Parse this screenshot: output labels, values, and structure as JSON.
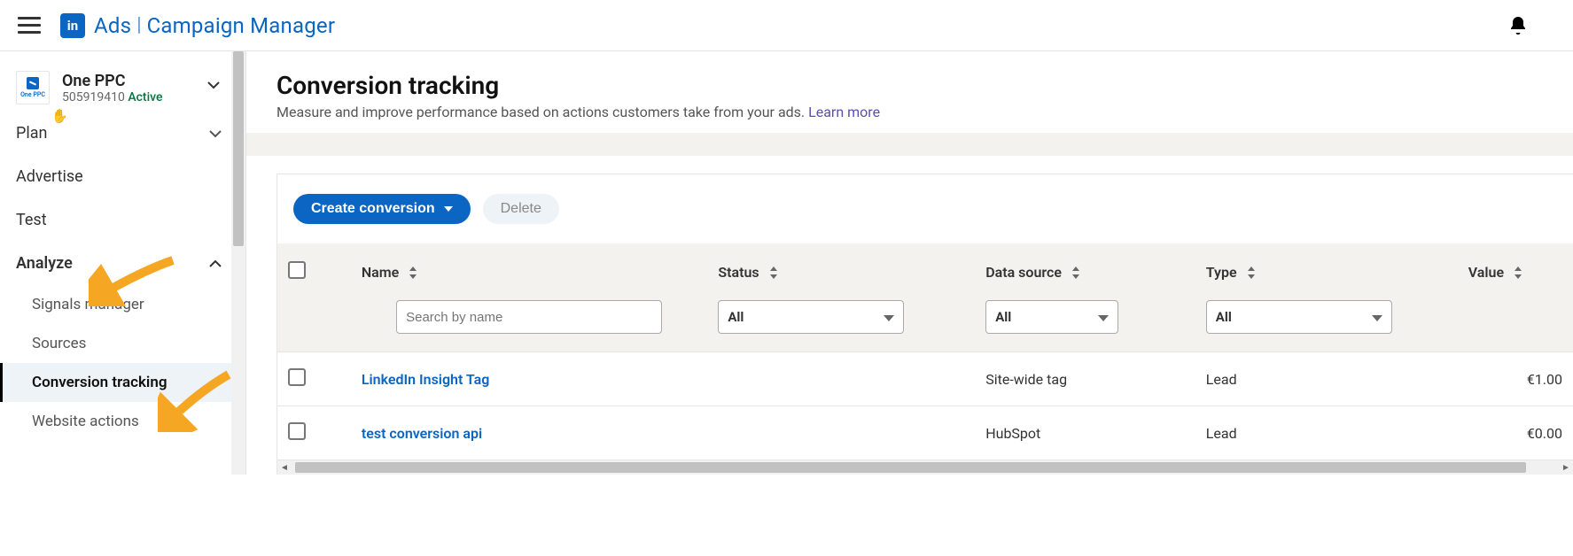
{
  "header": {
    "brand_ads": "Ads",
    "brand_cm": "Campaign Manager",
    "logo_text": "in"
  },
  "account": {
    "name": "One PPC",
    "id": "505919410",
    "status": "Active",
    "logo_label": "One PPC"
  },
  "sidebar": {
    "plan": "Plan",
    "advertise": "Advertise",
    "test": "Test",
    "analyze": "Analyze",
    "sub": {
      "signals": "Signals manager",
      "sources": "Sources",
      "conversion": "Conversion tracking",
      "website": "Website actions"
    }
  },
  "page": {
    "title": "Conversion tracking",
    "desc": "Measure and improve performance based on actions customers take from your ads. ",
    "learn": "Learn more"
  },
  "toolbar": {
    "create": "Create conversion",
    "delete": "Delete"
  },
  "table": {
    "columns": {
      "name": "Name",
      "status": "Status",
      "source": "Data source",
      "type": "Type",
      "value": "Value"
    },
    "filters": {
      "search_placeholder": "Search by name",
      "status": "All",
      "source": "All",
      "type": "All"
    },
    "rows": [
      {
        "name": "LinkedIn Insight Tag",
        "status": "",
        "source": "Site-wide tag",
        "type": "Lead",
        "value": "€1.00"
      },
      {
        "name": "test conversion api",
        "status": "",
        "source": "HubSpot",
        "type": "Lead",
        "value": "€0.00"
      }
    ]
  }
}
